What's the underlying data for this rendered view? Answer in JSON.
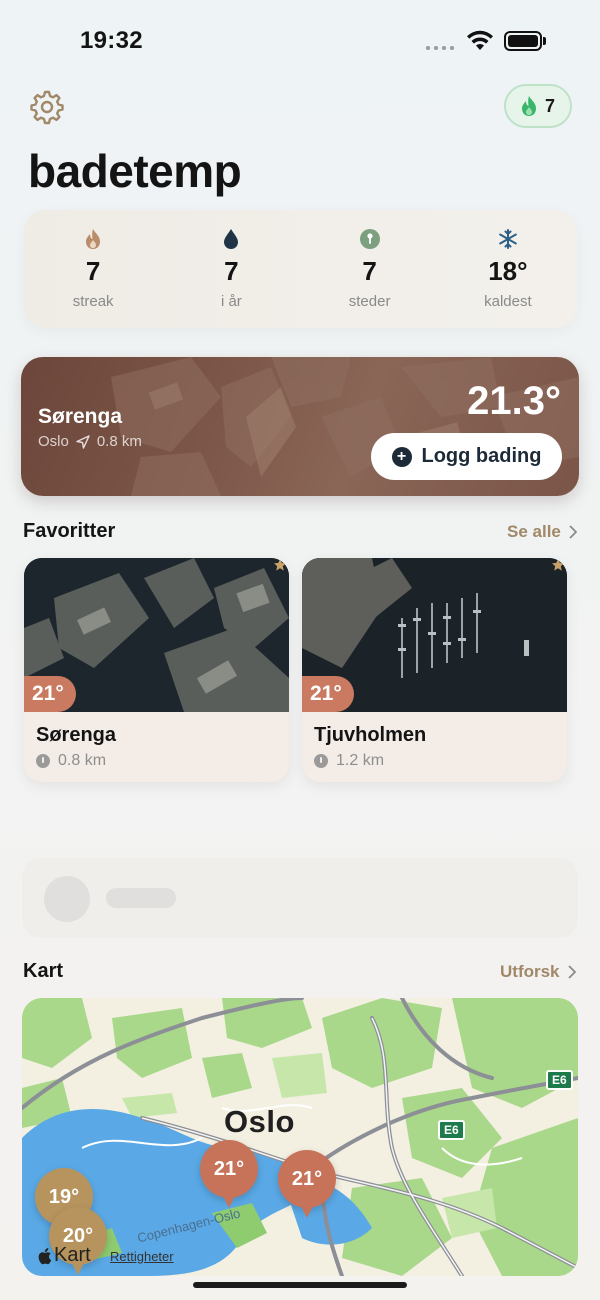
{
  "status_bar": {
    "time": "19:32"
  },
  "header": {
    "title": "badetemp",
    "streak_count": "7"
  },
  "stats": [
    {
      "icon": "flame-icon",
      "value": "7",
      "label": "streak"
    },
    {
      "icon": "drop-icon",
      "value": "7",
      "label": "i år"
    },
    {
      "icon": "pin-icon",
      "value": "7",
      "label": "steder"
    },
    {
      "icon": "snowflake-icon",
      "value": "18°",
      "label": "kaldest"
    }
  ],
  "hero": {
    "name": "Sørenga",
    "city": "Oslo",
    "distance": "0.8 km",
    "temperature": "21.3°",
    "action_label": "Logg bading"
  },
  "favorites": {
    "title": "Favoritter",
    "see_all": "Se alle",
    "items": [
      {
        "name": "Sørenga",
        "temperature": "21°",
        "distance": "0.8 km"
      },
      {
        "name": "Tjuvholmen",
        "temperature": "21°",
        "distance": "1.2 km"
      }
    ]
  },
  "map_section": {
    "title": "Kart",
    "explore": "Utforsk",
    "city": "Oslo",
    "road_label": "Copenhagen-Oslo",
    "highway": "E6",
    "brand": "Kart",
    "legal": "Rettigheter",
    "pins": [
      "21°",
      "21°",
      "19°",
      "20°"
    ]
  },
  "colors": {
    "accent": "#c97a60",
    "link": "#a08868",
    "streak_green": "#3bb56a"
  }
}
